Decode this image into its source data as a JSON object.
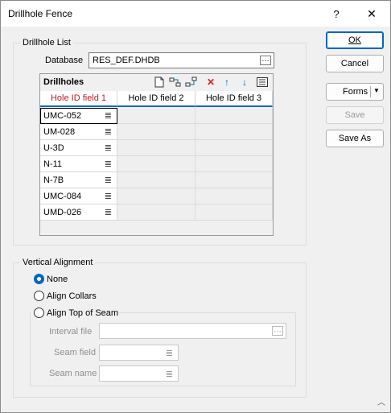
{
  "window": {
    "title": "Drillhole Fence",
    "help_glyph": "?",
    "close_glyph": "✕"
  },
  "buttons": {
    "ok": "OK",
    "cancel": "Cancel",
    "forms": "Forms",
    "save": "Save",
    "save_as": "Save As"
  },
  "drillhole_list": {
    "group_label": "Drillhole List",
    "database_label": "Database",
    "database_value": "RES_DEF.DHDB",
    "grid_title": "Drillholes",
    "columns": [
      "Hole ID field 1",
      "Hole ID field 2",
      "Hole ID field 3"
    ],
    "rows": [
      "UMC-052",
      "UM-028",
      "U-3D",
      "N-11",
      "N-7B",
      "UMC-084",
      "UMD-026"
    ]
  },
  "vertical_alignment": {
    "group_label": "Vertical Alignment",
    "options": [
      "None",
      "Align Collars",
      "Align Top of Seam"
    ],
    "selected": "None",
    "interval_file_label": "Interval file",
    "seam_field_label": "Seam field",
    "seam_name_label": "Seam name"
  },
  "icons": [
    "new-icon",
    "insert-row-icon",
    "append-row-icon",
    "delete-icon",
    "move-up-icon",
    "move-down-icon",
    "list-icon",
    "ellipsis-icon",
    "list-menu-icon",
    "dropdown-arrow-icon",
    "help-icon",
    "close-icon"
  ],
  "colors": {
    "accent": "#0067c0",
    "delete": "#d42020",
    "active_header": "#b22222"
  }
}
